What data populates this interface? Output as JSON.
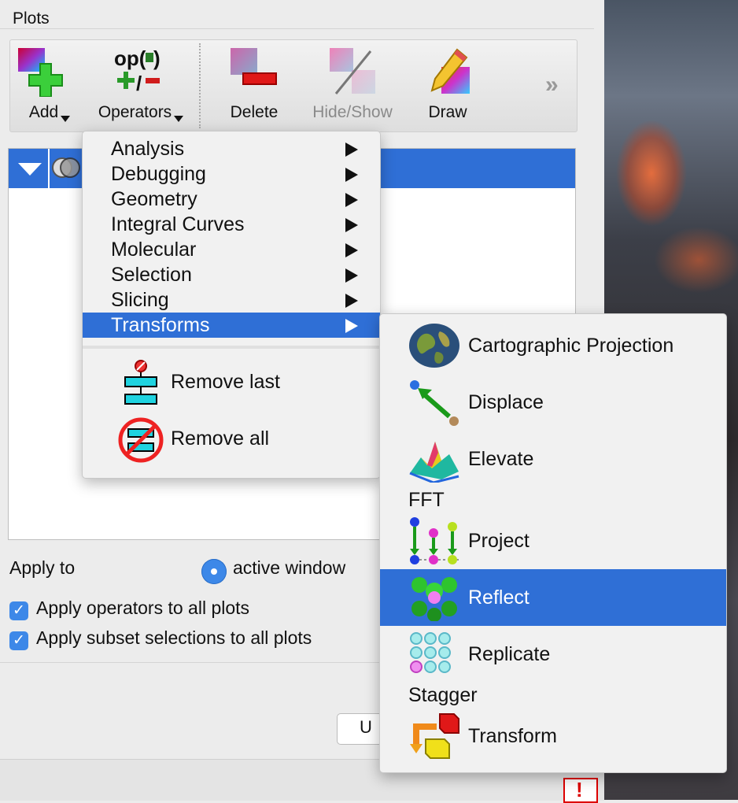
{
  "panel": {
    "title": "Plots"
  },
  "toolbar": {
    "add": "Add",
    "operators": "Operators",
    "delete": "Delete",
    "hide_show": "Hide/Show",
    "draw": "Draw",
    "more": "»"
  },
  "apply": {
    "label": "Apply to",
    "radio_active": "active window",
    "radio_active_selected": true,
    "check_operators": "Apply operators to all plots",
    "check_operators_checked": true,
    "check_subsets": "Apply subset selections to all plots",
    "check_subsets_checked": true
  },
  "bottom": {
    "unpost_partial": "U"
  },
  "operators_menu": {
    "items": [
      {
        "label": "Analysis"
      },
      {
        "label": "Debugging"
      },
      {
        "label": "Geometry"
      },
      {
        "label": "Integral Curves"
      },
      {
        "label": "Molecular"
      },
      {
        "label": "Selection"
      },
      {
        "label": "Slicing"
      },
      {
        "label": "Transforms",
        "highlighted": true
      }
    ],
    "remove_last": "Remove last",
    "remove_all": "Remove all"
  },
  "transforms_menu": {
    "items": [
      {
        "label": "Cartographic Projection",
        "icon": "globe-icon"
      },
      {
        "label": "Displace",
        "icon": "displace-arrow-icon"
      },
      {
        "label": "Elevate",
        "icon": "elevate-surface-icon"
      },
      {
        "label": "FFT"
      },
      {
        "label": "Project",
        "icon": "project-icon"
      },
      {
        "label": "Reflect",
        "icon": "reflect-icon",
        "highlighted": true
      },
      {
        "label": "Replicate",
        "icon": "replicate-grid-icon"
      },
      {
        "label": "Stagger"
      },
      {
        "label": "Transform",
        "icon": "transform-cubes-icon"
      }
    ]
  },
  "colors": {
    "selection": "#2f6fd6",
    "checkbox": "#3d88e8"
  }
}
